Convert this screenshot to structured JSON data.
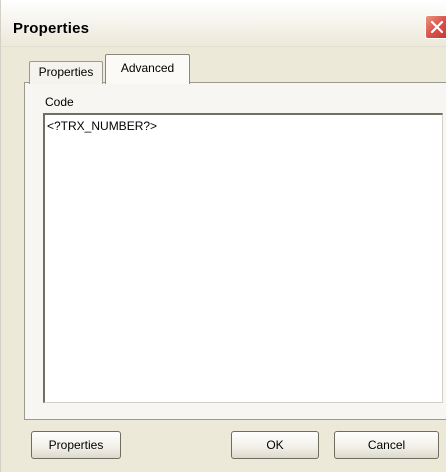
{
  "window": {
    "title": "Properties"
  },
  "tabs": [
    {
      "label": "Properties",
      "active": false
    },
    {
      "label": "Advanced",
      "active": true
    }
  ],
  "code": {
    "label": "Code",
    "value": "<?TRX_NUMBER?>"
  },
  "buttons": {
    "properties_label": "Properties",
    "ok_label": "OK",
    "cancel_label": "Cancel"
  },
  "icons": {
    "close": "close-icon"
  },
  "colors": {
    "close_button": "#d9534f",
    "dialog_background": "#ece9d8"
  }
}
